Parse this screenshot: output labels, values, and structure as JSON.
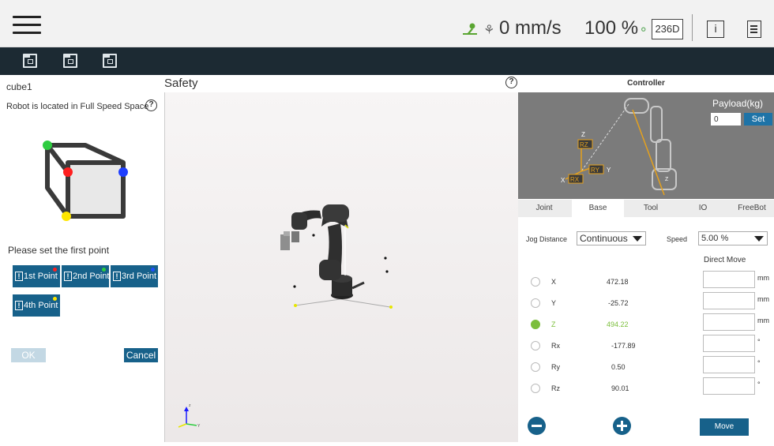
{
  "topbar": {
    "speed": "0 mm/s",
    "speed_percent": "100 %",
    "counter": "236D",
    "info_label": "i",
    "icons": [
      "menu-icon",
      "robot-status-icon",
      "speed-icon",
      "link-icon",
      "info-icon",
      "document-icon"
    ]
  },
  "toolbar": {
    "icons": [
      "add-folder-icon",
      "user-folder-icon",
      "export-folder-icon"
    ]
  },
  "left": {
    "cube_name": "cube1",
    "location_text": "Robot is located in Full Speed Space",
    "help": "?",
    "instruction": "Please set the first point",
    "points": [
      {
        "label": "1st Point",
        "dot_color": "#ff2020"
      },
      {
        "label": "2nd Point",
        "dot_color": "#2ecc40"
      },
      {
        "label": "3rd Point",
        "dot_color": "#1f4fff"
      },
      {
        "label": "4th Point",
        "dot_color": "#ffe600"
      }
    ],
    "ok_label": "OK",
    "cancel_label": "Cancel"
  },
  "center": {
    "title": "Safety",
    "help": "?"
  },
  "controller": {
    "title": "Controller",
    "payload_label": "Payload(kg)",
    "payload_value": "0",
    "set_label": "Set",
    "tabs": [
      "Joint",
      "Base",
      "Tool",
      "IO",
      "FreeBot"
    ],
    "active_tab": "Base",
    "jog_distance_label": "Jog Distance",
    "jog_distance_value": "Continuous",
    "speed_label": "Speed",
    "speed_value": "5.00 %",
    "direct_move_label": "Direct Move",
    "axes": [
      {
        "name": "X",
        "value": "472.18",
        "unit": "mm",
        "selected": false
      },
      {
        "name": "Y",
        "value": "-25.72",
        "unit": "mm",
        "selected": false
      },
      {
        "name": "Z",
        "value": "494.22",
        "unit": "mm",
        "selected": true
      },
      {
        "name": "Rx",
        "value": "-177.89",
        "unit": "°",
        "selected": false
      },
      {
        "name": "Ry",
        "value": "0.50",
        "unit": "°",
        "selected": false
      },
      {
        "name": "Rz",
        "value": "90.01",
        "unit": "°",
        "selected": false
      }
    ],
    "move_label": "Move",
    "accent": "#17618a",
    "selected_color": "#7bbe3b"
  }
}
